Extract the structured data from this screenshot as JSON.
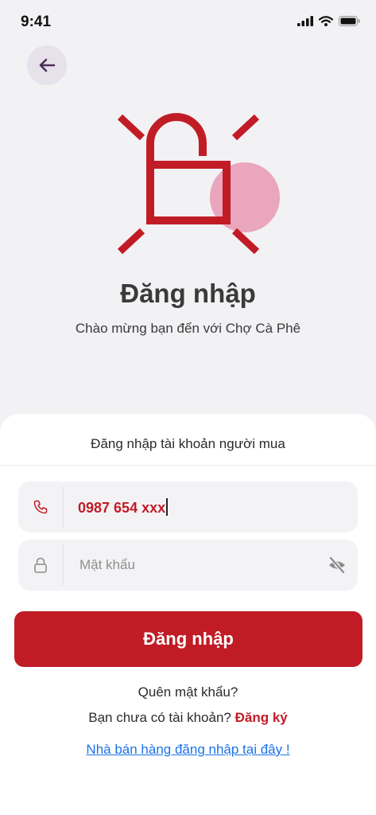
{
  "status_bar": {
    "time": "9:41"
  },
  "header": {
    "title": "Đăng nhập",
    "subtitle": "Chào mừng bạn đến với Chợ Cà Phê"
  },
  "login_card": {
    "title": "Đăng nhập tài khoản người mua",
    "phone_value": "0987 654 xxx",
    "password_placeholder": "Mật khẩu",
    "submit_label": "Đăng nhập",
    "forgot_password": "Quên mật khẩu?",
    "no_account_text": "Bạn chưa có tài khoản?",
    "register_link": "Đăng ký",
    "seller_link": "Nhà bán hàng đăng nhập tại đây !"
  },
  "colors": {
    "primary": "#c11c26",
    "accent_pink": "#e9a6bc",
    "link": "#1a73e8"
  },
  "icons": [
    "back-arrow-icon",
    "unlocked-padlock-icon",
    "phone-icon",
    "lock-icon",
    "eye-off-icon",
    "cellular-signal-icon",
    "wifi-icon",
    "battery-icon"
  ]
}
